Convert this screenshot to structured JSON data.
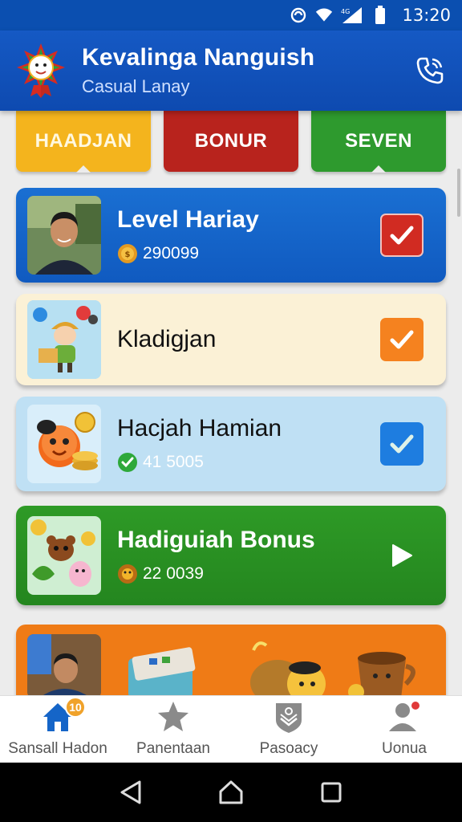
{
  "status_bar": {
    "time": "13:20",
    "network_label": "4G"
  },
  "header": {
    "title": "Kevalinga Nanguish",
    "subtitle": "Casual Lanay"
  },
  "tabs": [
    {
      "label": "HAADJAN",
      "color": "#f4b41d"
    },
    {
      "label": "BONUR",
      "color": "#b8231d"
    },
    {
      "label": "SEVEN",
      "color": "#2e9a2e"
    }
  ],
  "cards": [
    {
      "title": "Level Hariay",
      "stat": "290099",
      "stat_icon": "coin-icon",
      "action": "checked",
      "color": "#1a6fd2"
    },
    {
      "title": "Kladigjan",
      "action": "checked",
      "color": "#fbf1d6"
    },
    {
      "title": "Hacjah Hamian",
      "stat": "41 5005",
      "stat_icon": "check-circle-icon",
      "action": "checked",
      "color": "#bfe0f4"
    },
    {
      "title": "Hadiguiah Bonus",
      "stat": "22 0039",
      "stat_icon": "coin-icon",
      "action": "play",
      "color": "#2e9a26"
    },
    {
      "title": "",
      "color": "#ef7b16"
    }
  ],
  "bottom_nav": [
    {
      "label": "Sansall Hadon",
      "icon": "home-icon",
      "badge": "10"
    },
    {
      "label": "Panentaan",
      "icon": "star-icon"
    },
    {
      "label": "Pasoacy",
      "icon": "shield-icon"
    },
    {
      "label": "Uonua",
      "icon": "person-icon",
      "dot": true
    }
  ]
}
